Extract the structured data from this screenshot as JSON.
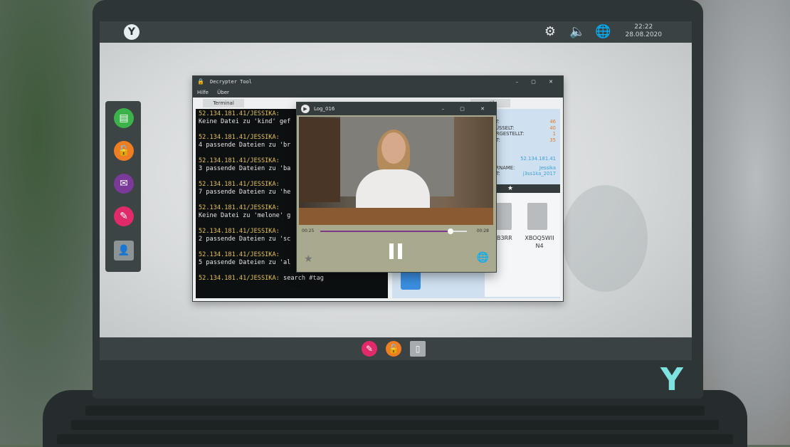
{
  "topbar": {
    "time": "22:22",
    "date": "28.08.2020",
    "icons": [
      "settings-icon",
      "speaker-icon",
      "globe-icon"
    ]
  },
  "decrypter": {
    "title": "Decrypter Tool",
    "menu": [
      "Hilfe",
      "Über"
    ],
    "terminal_tab": "Terminal",
    "stat_tab": "...tik",
    "terminal_lines": [
      {
        "prompt": "52.134.181.41/JESSIKA:",
        "output": "Keine Datei zu 'kind' gef"
      },
      {
        "prompt": "52.134.181.41/JESSIKA:",
        "output": "4 passende Dateien zu 'br"
      },
      {
        "prompt": "52.134.181.41/JESSIKA:",
        "output": "3 passende Dateien zu 'ba"
      },
      {
        "prompt": "52.134.181.41/JESSIKA:",
        "output": "7 passende Dateien zu 'he"
      },
      {
        "prompt": "52.134.181.41/JESSIKA:",
        "output": "Keine Datei zu 'melone' g"
      },
      {
        "prompt": "52.134.181.41/JESSIKA:",
        "output": "2 passende Dateien zu 'sc"
      },
      {
        "prompt": "52.134.181.41/JESSIKA:",
        "output": "5 passende Dateien zu 'al"
      }
    ],
    "last_prompt": "52.134.181.41/JESSIKA:",
    "last_command": "search #tag",
    "stats": [
      {
        "label": "...CKT:",
        "value": "46"
      },
      {
        "label": "...HLÜSSELT:",
        "value": "40"
      },
      {
        "label": "...HERGESTELLT:",
        "value": "1"
      },
      {
        "label": "...NET:",
        "value": "35"
      }
    ],
    "ip": "52.134.181.41",
    "username_label": "...ZERNAME:",
    "username": "Jessika",
    "password_label": "...ORT:",
    "password": "j3ss1ka_2017",
    "files": [
      "...B3RR",
      "XBOQ5WII N4"
    ]
  },
  "log_player": {
    "title": "Log_016",
    "time_current": "00:25",
    "time_total": "00:28",
    "progress": 0.89
  },
  "dock_left": [
    "chat",
    "unlock",
    "mail",
    "notes",
    "contacts"
  ],
  "taskbar": [
    "notes",
    "unlock",
    "file"
  ]
}
